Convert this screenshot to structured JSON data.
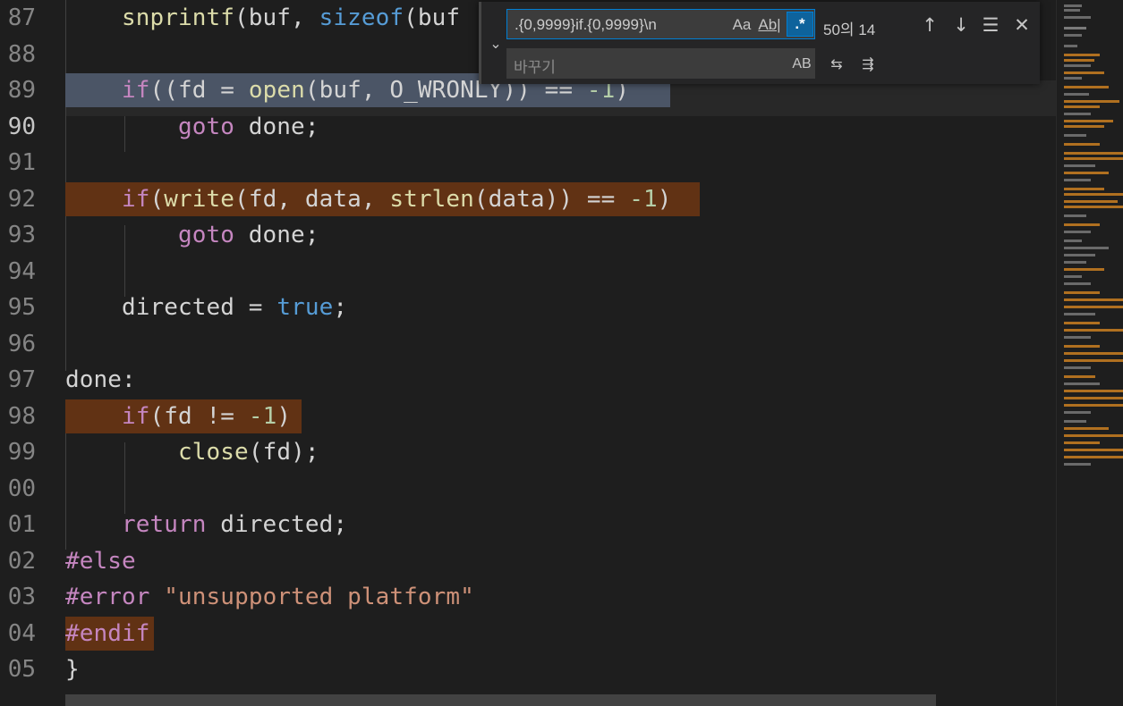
{
  "editor": {
    "lines": [
      {
        "num": "87",
        "active": false,
        "tokens": [
          {
            "t": "    "
          },
          {
            "t": "snprintf",
            "c": "fn"
          },
          {
            "t": "(buf, "
          },
          {
            "t": "sizeof",
            "c": "bl"
          },
          {
            "t": "(buf"
          }
        ]
      },
      {
        "num": "88",
        "active": false,
        "tokens": []
      },
      {
        "num": "89",
        "active": false,
        "tokens": [
          {
            "t": "    "
          },
          {
            "t": "if",
            "c": "kw"
          },
          {
            "t": "((fd = "
          },
          {
            "t": "open",
            "c": "fn"
          },
          {
            "t": "(buf, O_WRONLY)) == "
          },
          {
            "t": "-1",
            "c": "num"
          },
          {
            "t": ")"
          }
        ]
      },
      {
        "num": "90",
        "active": true,
        "tokens": [
          {
            "t": "        "
          },
          {
            "t": "goto",
            "c": "kw"
          },
          {
            "t": " done;"
          }
        ]
      },
      {
        "num": "91",
        "active": false,
        "tokens": []
      },
      {
        "num": "92",
        "active": false,
        "tokens": [
          {
            "t": "    "
          },
          {
            "t": "if",
            "c": "kw"
          },
          {
            "t": "("
          },
          {
            "t": "write",
            "c": "fn"
          },
          {
            "t": "(fd, data, "
          },
          {
            "t": "strlen",
            "c": "fn"
          },
          {
            "t": "(data)) == "
          },
          {
            "t": "-1",
            "c": "num"
          },
          {
            "t": ")"
          }
        ]
      },
      {
        "num": "93",
        "active": false,
        "tokens": [
          {
            "t": "        "
          },
          {
            "t": "goto",
            "c": "kw"
          },
          {
            "t": " done;"
          }
        ]
      },
      {
        "num": "94",
        "active": false,
        "tokens": []
      },
      {
        "num": "95",
        "active": false,
        "tokens": [
          {
            "t": "    directed = "
          },
          {
            "t": "true",
            "c": "bl"
          },
          {
            "t": ";"
          }
        ]
      },
      {
        "num": "96",
        "active": false,
        "tokens": []
      },
      {
        "num": "97",
        "active": false,
        "tokens": [
          {
            "t": "done:"
          }
        ]
      },
      {
        "num": "98",
        "active": false,
        "tokens": [
          {
            "t": "    "
          },
          {
            "t": "if",
            "c": "kw"
          },
          {
            "t": "(fd != "
          },
          {
            "t": "-1",
            "c": "num"
          },
          {
            "t": ")"
          }
        ]
      },
      {
        "num": "99",
        "active": false,
        "tokens": [
          {
            "t": "        "
          },
          {
            "t": "close",
            "c": "fn"
          },
          {
            "t": "(fd);"
          }
        ]
      },
      {
        "num": "00",
        "active": false,
        "tokens": []
      },
      {
        "num": "01",
        "active": false,
        "tokens": [
          {
            "t": "    "
          },
          {
            "t": "return",
            "c": "kw"
          },
          {
            "t": " directed;"
          }
        ]
      },
      {
        "num": "02",
        "active": false,
        "tokens": [
          {
            "t": "#else",
            "c": "kw"
          }
        ]
      },
      {
        "num": "03",
        "active": false,
        "tokens": [
          {
            "t": "#error",
            "c": "kw"
          },
          {
            "t": " "
          },
          {
            "t": "\"unsupported platform\"",
            "c": "str"
          }
        ]
      },
      {
        "num": "04",
        "active": false,
        "tokens": [
          {
            "t": "#endif",
            "c": "kw"
          }
        ]
      },
      {
        "num": "05",
        "active": false,
        "tokens": [
          {
            "t": "}"
          }
        ]
      }
    ]
  },
  "find_widget": {
    "find_value": ".{0,9999}if.{0,9999}\\n",
    "match_case_label": "Aa",
    "whole_word_label": "Ab|",
    "regex_label": ".*",
    "match_count": "50의 14",
    "prev_icon": "↑",
    "next_icon": "↓",
    "selection_icon": "☰",
    "close_icon": "✕",
    "toggle_icon": "⌄",
    "replace_placeholder": "바꾸기",
    "preserve_case_label": "AB",
    "replace_one_icon": "⇆",
    "replace_all_icon": "⇶"
  },
  "colors": {
    "background": "#1e1e1e",
    "selection": "#4b5566",
    "find_match": "#613214",
    "regex_active": "#0e639c",
    "keyword": "#c586c0",
    "function": "#dcdcaa",
    "builtin": "#569cd6",
    "number": "#b5cea8",
    "string": "#ce9178"
  }
}
